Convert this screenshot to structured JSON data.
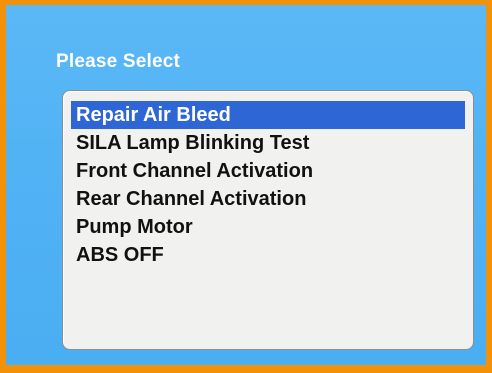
{
  "dialog": {
    "title": "Please Select"
  },
  "menu": {
    "selected_index": 0,
    "items": [
      {
        "label": "Repair Air Bleed"
      },
      {
        "label": "SILA Lamp Blinking Test"
      },
      {
        "label": "Front Channel Activation"
      },
      {
        "label": "Rear Channel Activation"
      },
      {
        "label": "Pump Motor"
      },
      {
        "label": "ABS OFF"
      }
    ]
  },
  "colors": {
    "frame": "#f39208",
    "screen_background": "#52b3f4",
    "panel_background": "#f1f1ef",
    "selection_highlight": "#2e66d6",
    "title_text": "#ffffff",
    "item_text": "#111111"
  }
}
